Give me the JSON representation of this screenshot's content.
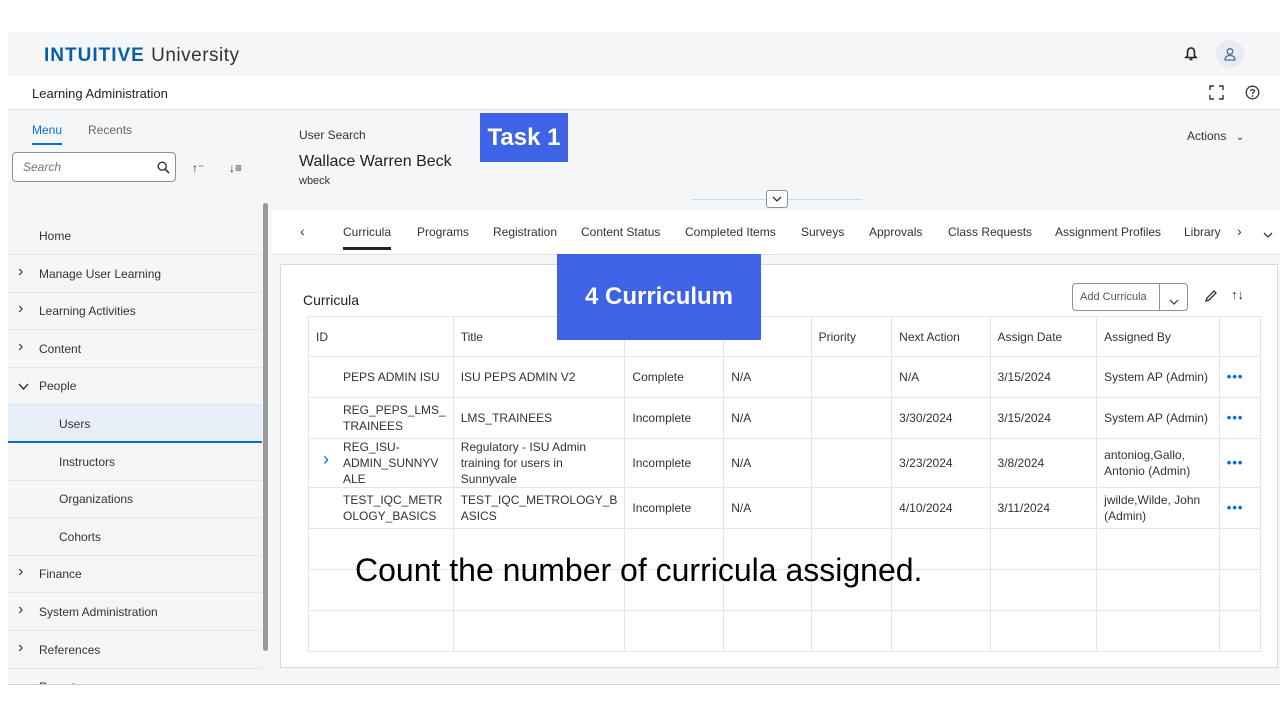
{
  "shell": {
    "logo_brand": "INTUITIVE",
    "logo_suffix": "University",
    "subheader_title": "Learning Administration"
  },
  "sidebar": {
    "tabs": [
      "Menu",
      "Recents"
    ],
    "search_placeholder": "Search",
    "items": [
      {
        "label": "Home",
        "expandable": false
      },
      {
        "label": "Manage User Learning",
        "expandable": true
      },
      {
        "label": "Learning Activities",
        "expandable": true
      },
      {
        "label": "Content",
        "expandable": true
      },
      {
        "label": "People",
        "expandable": true,
        "expanded": true
      },
      {
        "label": "Users",
        "sub": true,
        "selected": true
      },
      {
        "label": "Instructors",
        "sub": true
      },
      {
        "label": "Organizations",
        "sub": true
      },
      {
        "label": "Cohorts",
        "sub": true
      },
      {
        "label": "Finance",
        "expandable": true
      },
      {
        "label": "System Administration",
        "expandable": true
      },
      {
        "label": "References",
        "expandable": true
      },
      {
        "label": "Reports",
        "expandable": false
      }
    ]
  },
  "header": {
    "breadcrumb": "User Search",
    "user_name": "Wallace Warren Beck",
    "user_id": "wbeck",
    "actions_label": "Actions"
  },
  "tabs": [
    "Curricula",
    "Programs",
    "Registration",
    "Content Status",
    "Completed Items",
    "Surveys",
    "Approvals",
    "Class Requests",
    "Assignment Profiles",
    "Library"
  ],
  "panel": {
    "title": "Curricula",
    "add_button_label": "Add Curricula",
    "columns": [
      "ID",
      "Title",
      "",
      "",
      "Priority",
      "Next Action",
      "Assign Date",
      "Assigned By",
      ""
    ],
    "rows": [
      {
        "id": "PEPS ADMIN ISU",
        "title": "ISU PEPS ADMIN V2",
        "status": "Complete",
        "required_date": "N/A",
        "priority": "",
        "next_action": "N/A",
        "assign_date": "3/15/2024",
        "assigned_by": "System AP (Admin)",
        "expandable": false
      },
      {
        "id": "REG_PEPS_LMS_ TRAINEES",
        "title": "LMS_TRAINEES",
        "status": "Incomplete",
        "required_date": "N/A",
        "priority": "",
        "next_action": "3/30/2024",
        "assign_date": "3/15/2024",
        "assigned_by": "System AP (Admin)",
        "expandable": false
      },
      {
        "id": "REG_ISU- ADMIN_SUNNYV ALE",
        "title": "Regulatory - ISU Admin training for users in Sunnyvale",
        "status": "Incomplete",
        "required_date": "N/A",
        "priority": "",
        "next_action": "3/23/2024",
        "assign_date": "3/8/2024",
        "assigned_by": "antoniog,Gallo, Antonio (Admin)",
        "expandable": true
      },
      {
        "id": "TEST_IQC_METR OLOGY_BASICS",
        "title": "TEST_IQC_METROLOGY_B ASICS",
        "status": "Incomplete",
        "required_date": "N/A",
        "priority": "",
        "next_action": "4/10/2024",
        "assign_date": "3/11/2024",
        "assigned_by": "jwilde,Wilde, John (Admin)",
        "expandable": false
      }
    ],
    "more_glyph": "•••"
  },
  "overlay": {
    "task_badge": "Task 1",
    "count_badge": "4 Curriculum",
    "instruction": "Count the number of curricula assigned."
  },
  "colors": {
    "accent": "#0a6ed1",
    "badge": "#3e63e6",
    "selected_bg": "#e7eef7"
  }
}
